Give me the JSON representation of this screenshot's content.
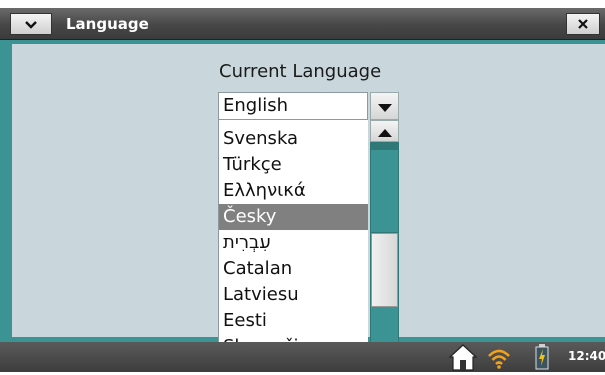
{
  "window": {
    "title": "Language"
  },
  "content": {
    "heading": "Current Language"
  },
  "select": {
    "value": "English",
    "options": [
      "Svenska",
      "Türkçe",
      "Ελληνικά",
      "Česky",
      "עִבְרִית",
      "Catalan",
      "Latviesu",
      "Eesti",
      "Slovenčina"
    ],
    "highlighted": "Česky"
  },
  "taskbar": {
    "clock": "12:40"
  },
  "icons": {
    "menu": "chevron-down-icon",
    "close": "close-icon",
    "home": "home-icon",
    "wifi": "wifi-icon",
    "battery": "battery-icon"
  },
  "colors": {
    "frame": "#3b9493",
    "background": "#c9d7dd",
    "selection": "#808080",
    "titlebar": "#474747"
  }
}
